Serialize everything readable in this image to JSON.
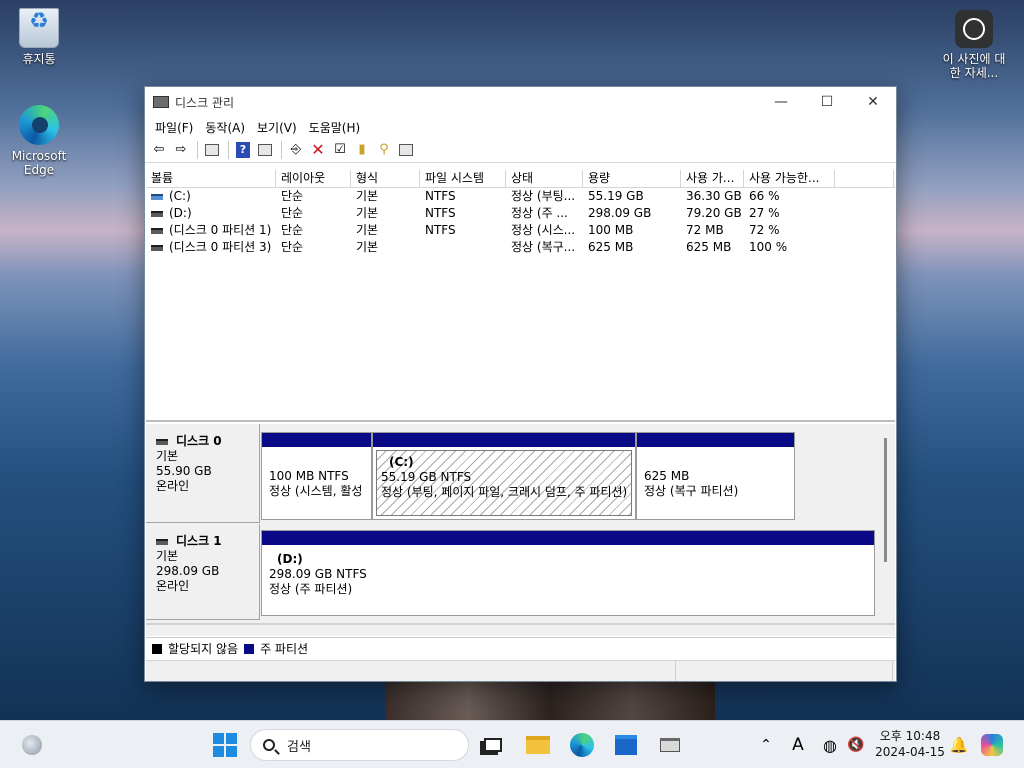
{
  "desktop": {
    "icons": [
      {
        "label": "휴지통"
      },
      {
        "label": "Microsoft Edge"
      },
      {
        "label": "이 사진에 대한 자세..."
      }
    ]
  },
  "window": {
    "title": "디스크 관리",
    "controls": {
      "minimize": "—",
      "maximize": "☐",
      "close": "✕"
    },
    "menu": [
      "파일(F)",
      "동작(A)",
      "보기(V)",
      "도움말(H)"
    ],
    "toolbar": [
      "back-icon",
      "forward-icon",
      "properties-panel-icon",
      "help-icon",
      "view-icon",
      "connect-icon",
      "delete-icon",
      "check-icon",
      "folder-up-icon",
      "search-folder-icon",
      "settings-icon"
    ]
  },
  "volume_list": {
    "headers": [
      "볼륨",
      "레이아웃",
      "형식",
      "파일 시스템",
      "상태",
      "용량",
      "사용 가...",
      "사용 가능한...",
      ""
    ],
    "rows": [
      {
        "volume": "(C:)",
        "layout": "단순",
        "type": "기본",
        "fs": "NTFS",
        "status": "정상 (부팅...",
        "capacity": "55.19 GB",
        "free": "36.30 GB",
        "pct": "66 %"
      },
      {
        "volume": "(D:)",
        "layout": "단순",
        "type": "기본",
        "fs": "NTFS",
        "status": "정상 (주 ...",
        "capacity": "298.09 GB",
        "free": "79.20 GB",
        "pct": "27 %"
      },
      {
        "volume": "(디스크 0 파티션 1)",
        "layout": "단순",
        "type": "기본",
        "fs": "NTFS",
        "status": "정상 (시스...",
        "capacity": "100 MB",
        "free": "72 MB",
        "pct": "72 %"
      },
      {
        "volume": "(디스크 0 파티션 3)",
        "layout": "단순",
        "type": "기본",
        "fs": "",
        "status": "정상 (복구...",
        "capacity": "625 MB",
        "free": "625 MB",
        "pct": "100 %"
      }
    ]
  },
  "disks": [
    {
      "name": "디스크 0",
      "type": "기본",
      "size": "55.90 GB",
      "state": "온라인",
      "partitions": [
        {
          "label": "",
          "size": "100 MB NTFS",
          "status": "정상 (시스템, 활성"
        },
        {
          "label": "(C:)",
          "size": "55.19 GB NTFS",
          "status": "정상 (부팅, 페이지 파일, 크래시 덤프, 주 파티션)"
        },
        {
          "label": "",
          "size": "625 MB",
          "status": "정상 (복구 파티션)"
        }
      ]
    },
    {
      "name": "디스크 1",
      "type": "기본",
      "size": "298.09 GB",
      "state": "온라인",
      "partitions": [
        {
          "label": "(D:)",
          "size": "298.09 GB NTFS",
          "status": "정상 (주 파티션)"
        }
      ]
    }
  ],
  "legend": {
    "unallocated": "할당되지 않음",
    "primary": "주 파티션",
    "unallocated_color": "#000000",
    "primary_color": "#0a0a86"
  },
  "taskbar": {
    "search_placeholder": "검색",
    "time": "오후 10:48",
    "date": "2024-04-15",
    "ime": "A"
  }
}
